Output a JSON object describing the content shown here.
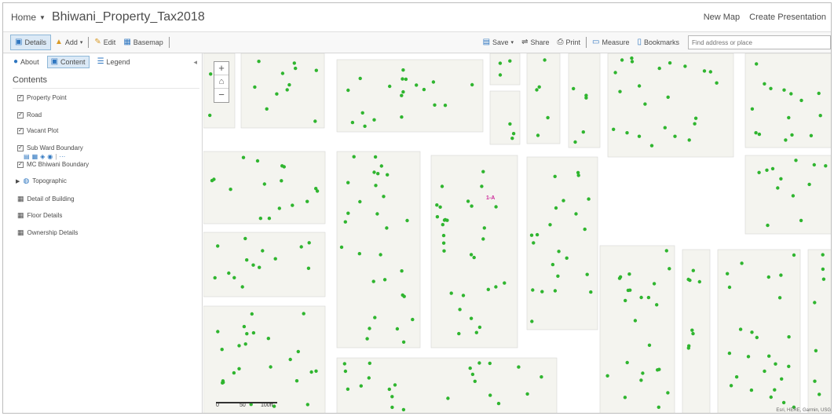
{
  "header": {
    "home_label": "Home",
    "map_title": "Bhiwani_Property_Tax2018",
    "new_map": "New Map",
    "create_presentation": "Create Presentation"
  },
  "toolbar": {
    "details": "Details",
    "add": "Add",
    "edit": "Edit",
    "basemap": "Basemap",
    "save": "Save",
    "share": "Share",
    "print": "Print",
    "measure": "Measure",
    "bookmarks": "Bookmarks",
    "search_placeholder": "Find address or place"
  },
  "panel": {
    "tabs": {
      "about": "About",
      "content": "Content",
      "legend": "Legend"
    },
    "contents_heading": "Contents",
    "layers": [
      "Property Point",
      "Road",
      "Vacant Plot",
      "Sub Ward Boundary",
      "MC Bhiwani Boundary",
      "Topographic",
      "Detail of Building",
      "Floor Details",
      "Ownership Details"
    ]
  },
  "map": {
    "label": "1-A",
    "scale": {
      "zero": "0",
      "mid": "50",
      "end": "100ft"
    },
    "attribution": "Esri, HERE, Garmin, USG",
    "colors": {
      "point": "#2fb52f",
      "road": "#ffffff",
      "block": "#f4f4ef",
      "label": "#cc2a9a"
    }
  }
}
